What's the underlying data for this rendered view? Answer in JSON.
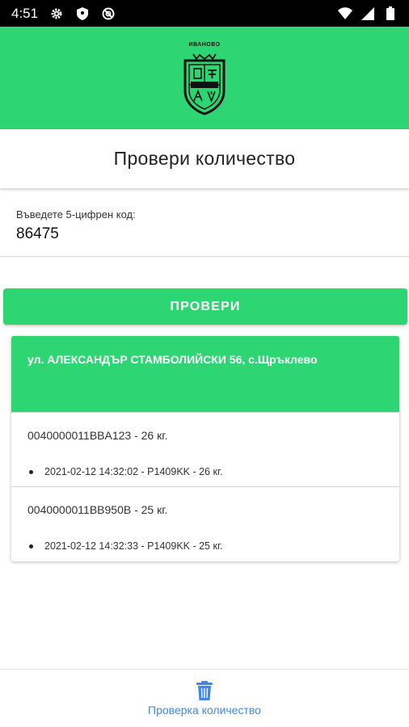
{
  "status_bar": {
    "time": "4:51",
    "icons": [
      "gear-icon",
      "shield-icon",
      "no-tracking-icon",
      "wifi-icon",
      "signal-icon",
      "battery-icon"
    ]
  },
  "header": {
    "logo_text": "ИВАНОВО",
    "background_color": "#2ed573"
  },
  "title": "Провери количество",
  "code_input": {
    "label": "Въведете 5-цифрен код:",
    "value": "86475"
  },
  "check_button": {
    "label": "ПРОВЕРИ"
  },
  "result": {
    "address": "ул. АЛЕКСАНДЪР СТАМБОЛИЙСКИ 56, с.Щръклево",
    "entries": [
      {
        "code": "0040000011BBA123 - 26 кг.",
        "detail": "2021-02-12 14:32:02 - P1409KK - 26 кг."
      },
      {
        "code": "0040000011BB950B - 25 кг.",
        "detail": "2021-02-12 14:32:33 - P1409KK - 25 кг."
      }
    ]
  },
  "bottom_nav": {
    "label": "Проверка количество",
    "icon": "trash-icon",
    "accent_color": "#3f88e8"
  }
}
